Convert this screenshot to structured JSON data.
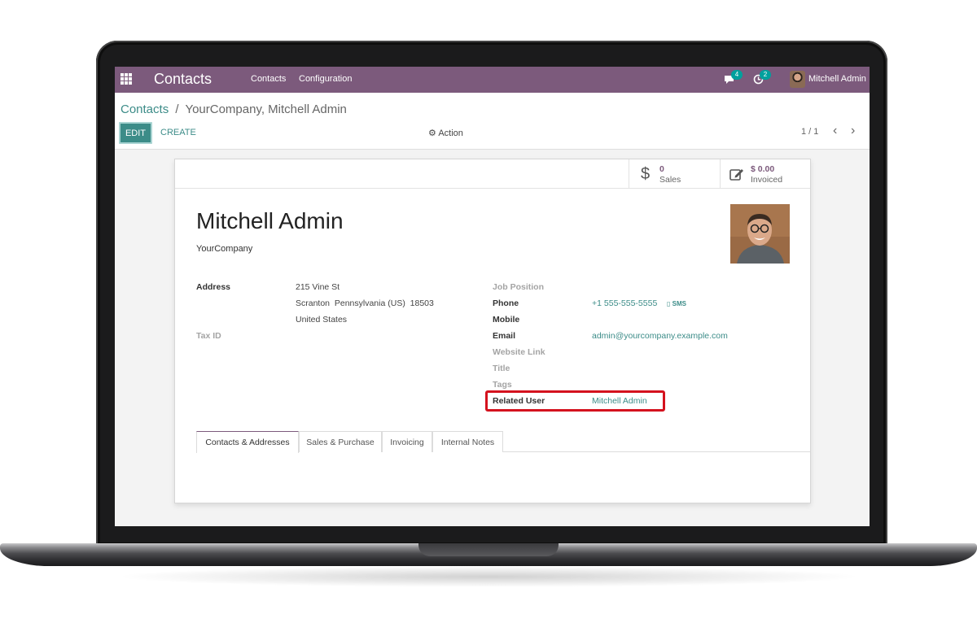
{
  "navbar": {
    "app_title": "Contacts",
    "menu": [
      "Contacts",
      "Configuration"
    ],
    "messages_count": "4",
    "activities_count": "2",
    "user_name": "Mitchell Admin"
  },
  "breadcrumb": {
    "parent": "Contacts",
    "separator": "/",
    "current": "YourCompany, Mitchell Admin"
  },
  "toolbar": {
    "edit_label": "EDIT",
    "create_label": "CREATE",
    "action_label": "Action",
    "pager": "1 / 1"
  },
  "stats": [
    {
      "value": "0",
      "label": "Sales",
      "icon": "dollar-icon"
    },
    {
      "value": "$ 0.00",
      "label": "Invoiced",
      "icon": "pencil-square-icon"
    }
  ],
  "partner": {
    "name": "Mitchell Admin",
    "company": "YourCompany"
  },
  "left_fields": {
    "address_label": "Address",
    "street": "215 Vine St",
    "city_line": "Scranton  Pennsylvania (US)  18503",
    "country": "United States",
    "tax_id_label": "Tax ID"
  },
  "right_fields": {
    "job_position_label": "Job Position",
    "phone_label": "Phone",
    "phone_value": "+1 555-555-5555",
    "sms_label": "SMS",
    "mobile_label": "Mobile",
    "email_label": "Email",
    "email_value": "admin@yourcompany.example.com",
    "website_label": "Website Link",
    "title_label": "Title",
    "tags_label": "Tags",
    "related_user_label": "Related User",
    "related_user_value": "Mitchell Admin"
  },
  "tabs": [
    "Contacts & Addresses",
    "Sales & Purchase",
    "Invoicing",
    "Internal Notes"
  ],
  "colors": {
    "navbar": "#7c5a7c",
    "accent": "#3c8c88",
    "highlight": "#d4121e"
  }
}
